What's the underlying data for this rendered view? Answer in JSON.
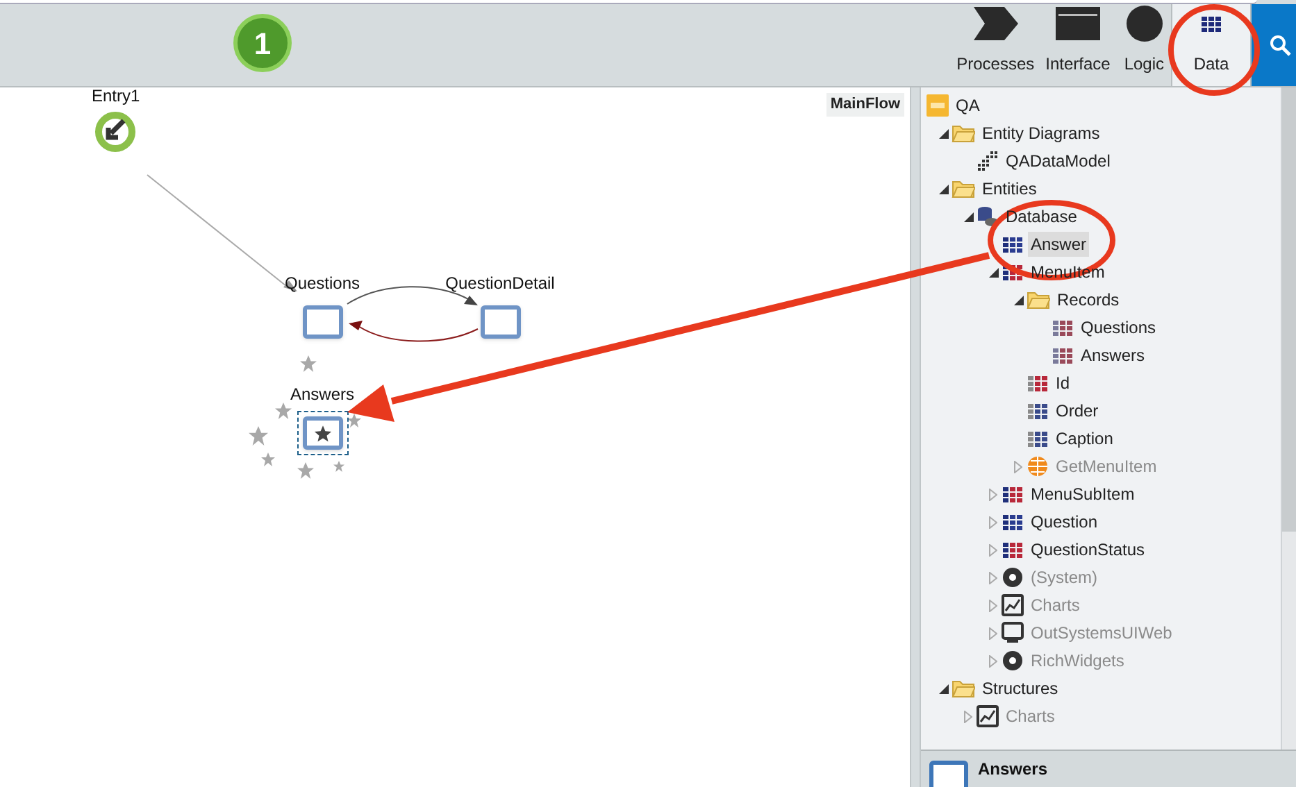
{
  "toolbar": {
    "step_badge": "1",
    "tabs": [
      {
        "label": "Processes",
        "kind": "processes",
        "selected": false
      },
      {
        "label": "Interface",
        "kind": "interface",
        "selected": false
      },
      {
        "label": "Logic",
        "kind": "logic",
        "selected": false
      },
      {
        "label": "Data",
        "kind": "data",
        "selected": true
      }
    ]
  },
  "canvas": {
    "flow_name": "MainFlow",
    "nodes": [
      {
        "label": "Entry1",
        "kind": "entry",
        "selected": false
      },
      {
        "label": "Questions",
        "kind": "screen",
        "selected": false
      },
      {
        "label": "QuestionDetail",
        "kind": "screen",
        "selected": false
      },
      {
        "label": "Answers",
        "kind": "screen",
        "selected": true
      }
    ]
  },
  "tree": [
    {
      "label": "QA",
      "kind": "module",
      "selected": false,
      "muted": false,
      "children": [
        {
          "label": "Entity Diagrams",
          "kind": "folder",
          "expanded": true,
          "selected": false,
          "muted": false,
          "children": [
            {
              "label": "QADataModel",
              "kind": "diagram",
              "selected": false,
              "muted": false
            }
          ]
        },
        {
          "label": "Entities",
          "kind": "folder",
          "expanded": true,
          "selected": false,
          "muted": false,
          "children": [
            {
              "label": "Database",
              "kind": "database",
              "expanded": true,
              "selected": false,
              "muted": false,
              "children": [
                {
                  "label": "Answer",
                  "kind": "entity",
                  "selected": true,
                  "muted": false
                },
                {
                  "label": "MenuItem",
                  "kind": "static-entity",
                  "expanded": true,
                  "selected": false,
                  "muted": false,
                  "children": [
                    {
                      "label": "Records",
                      "kind": "folder",
                      "expanded": true,
                      "selected": false,
                      "muted": false,
                      "children": [
                        {
                          "label": "Questions",
                          "kind": "record",
                          "selected": false,
                          "muted": false
                        },
                        {
                          "label": "Answers",
                          "kind": "record",
                          "selected": false,
                          "muted": false
                        }
                      ]
                    },
                    {
                      "label": "Id",
                      "kind": "attribute-id",
                      "selected": false,
                      "muted": false
                    },
                    {
                      "label": "Order",
                      "kind": "attribute",
                      "selected": false,
                      "muted": false
                    },
                    {
                      "label": "Caption",
                      "kind": "attribute",
                      "selected": false,
                      "muted": false
                    },
                    {
                      "label": "GetMenuItem",
                      "kind": "action",
                      "expanded": false,
                      "selected": false,
                      "muted": true
                    }
                  ]
                },
                {
                  "label": "MenuSubItem",
                  "kind": "static-entity",
                  "expanded": false,
                  "selected": false,
                  "muted": false
                },
                {
                  "label": "Question",
                  "kind": "entity",
                  "expanded": false,
                  "selected": false,
                  "muted": false
                },
                {
                  "label": "QuestionStatus",
                  "kind": "static-entity",
                  "expanded": false,
                  "selected": false,
                  "muted": false
                },
                {
                  "label": "(System)",
                  "kind": "reference",
                  "expanded": false,
                  "selected": false,
                  "muted": true
                },
                {
                  "label": "Charts",
                  "kind": "charts",
                  "expanded": false,
                  "selected": false,
                  "muted": true
                },
                {
                  "label": "OutSystemsUIWeb",
                  "kind": "web-ui",
                  "expanded": false,
                  "selected": false,
                  "muted": true
                },
                {
                  "label": "RichWidgets",
                  "kind": "reference",
                  "expanded": false,
                  "selected": false,
                  "muted": true
                }
              ]
            }
          ]
        },
        {
          "label": "Structures",
          "kind": "folder",
          "expanded": true,
          "selected": false,
          "muted": false,
          "children": [
            {
              "label": "Charts",
              "kind": "charts",
              "expanded": false,
              "selected": false,
              "muted": true
            }
          ]
        }
      ]
    }
  ],
  "details": {
    "title": "Answers"
  }
}
